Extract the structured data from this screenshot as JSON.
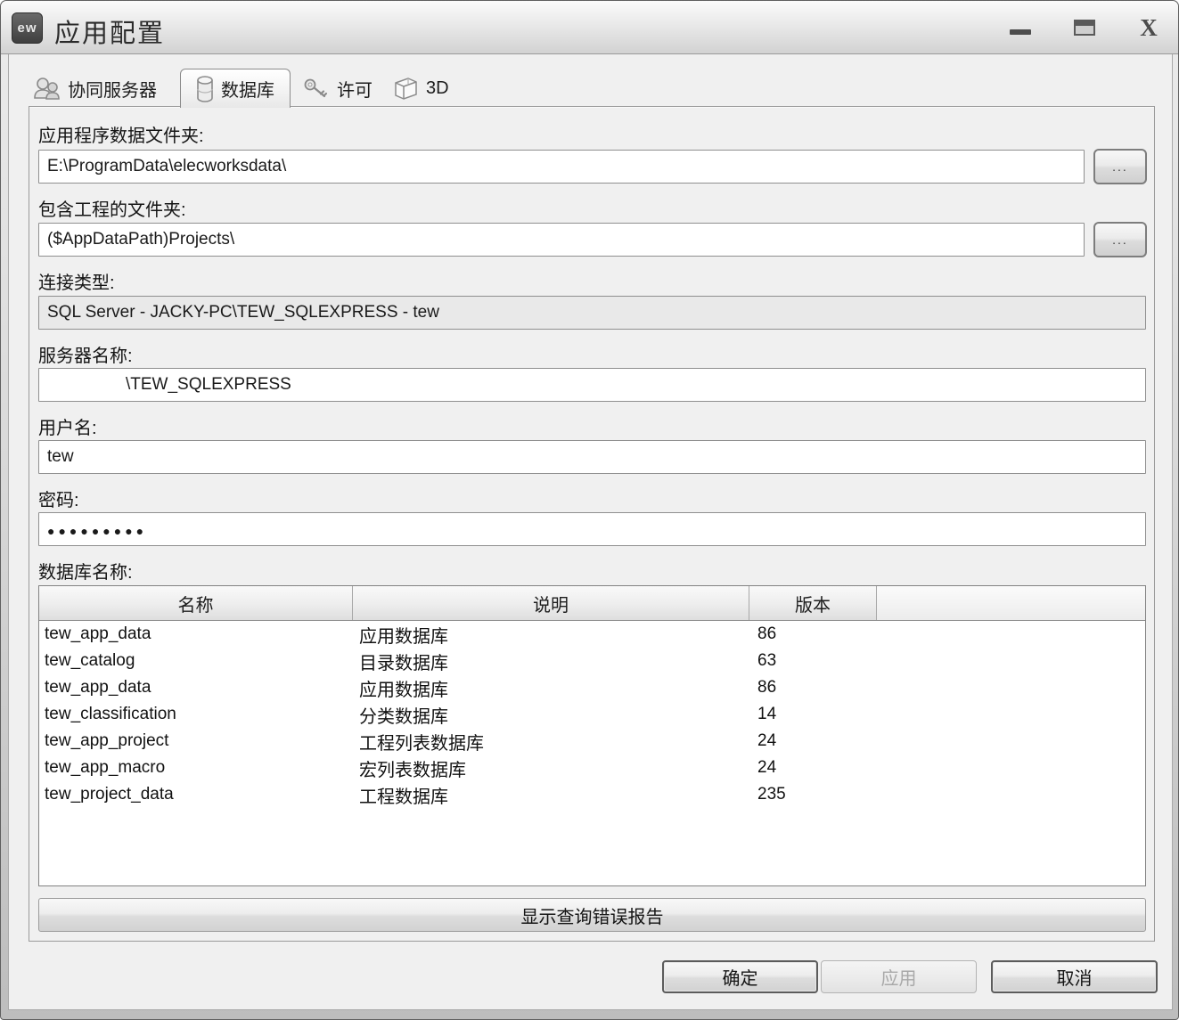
{
  "window": {
    "title": "应用配置",
    "icon_text": "ew",
    "controls": {
      "close": "X"
    }
  },
  "tabs": [
    {
      "label": "协同服务器",
      "selected": false
    },
    {
      "label": "数据库",
      "selected": true
    },
    {
      "label": "许可",
      "selected": false
    },
    {
      "label": "3D",
      "selected": false
    }
  ],
  "form": {
    "app_data_folder": {
      "label": "应用程序数据文件夹:",
      "value": "E:\\ProgramData\\elecworksdata\\",
      "browse_label": "..."
    },
    "projects_folder": {
      "label": "包含工程的文件夹:",
      "value": "($AppDataPath)Projects\\",
      "browse_label": "..."
    },
    "connection_type": {
      "label": "连接类型:",
      "value": "SQL Server - JACKY-PC\\TEW_SQLEXPRESS - tew"
    },
    "server_name": {
      "label": "服务器名称:",
      "value": "\\TEW_SQLEXPRESS"
    },
    "username": {
      "label": "用户名:",
      "value": "tew"
    },
    "password": {
      "label": "密码:",
      "value": "●●●●●●●●●"
    },
    "database_label": "数据库名称:"
  },
  "table": {
    "columns": [
      "名称",
      "说明",
      "版本"
    ],
    "rows": [
      {
        "name": "tew_app_data",
        "desc": "应用数据库",
        "version": "86"
      },
      {
        "name": "tew_catalog",
        "desc": "目录数据库",
        "version": "63"
      },
      {
        "name": "tew_app_data",
        "desc": "应用数据库",
        "version": "86"
      },
      {
        "name": "tew_classification",
        "desc": "分类数据库",
        "version": "14"
      },
      {
        "name": "tew_app_project",
        "desc": "工程列表数据库",
        "version": "24"
      },
      {
        "name": "tew_app_macro",
        "desc": "宏列表数据库",
        "version": "24"
      },
      {
        "name": "tew_project_data",
        "desc": "工程数据库",
        "version": "235"
      }
    ]
  },
  "buttons": {
    "show_error_report": "显示查询错误报告",
    "ok": "确定",
    "apply": "应用",
    "cancel": "取消"
  },
  "colors": {
    "frame": "#bdbdbd",
    "client_bg": "#f0f0f0",
    "field_border": "#8f8f8f",
    "readonly_bg": "#e9e9e9"
  }
}
